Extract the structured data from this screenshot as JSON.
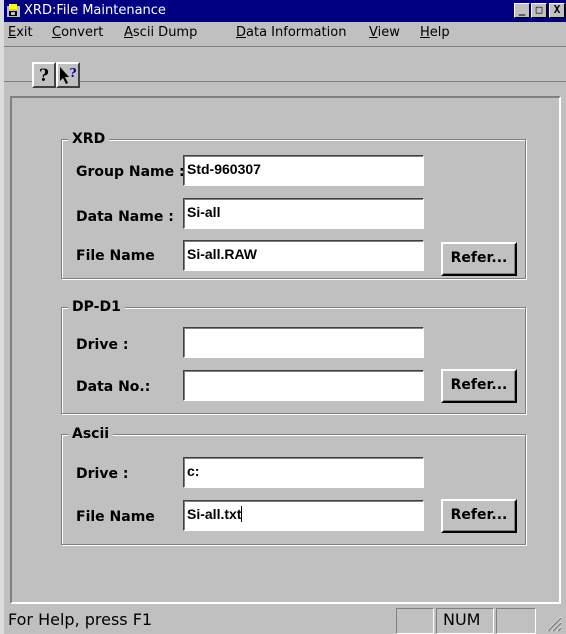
{
  "window": {
    "title": "XRD:File Maintenance",
    "controls": {
      "minimize": "_",
      "maximize": "□",
      "close": "X"
    }
  },
  "menu": [
    {
      "label": "Exit",
      "accel": "E",
      "rest": "xit"
    },
    {
      "label": "Convert",
      "accel": "C",
      "rest": "onvert"
    },
    {
      "label": "Ascii Dump",
      "accel": "A",
      "rest": "scii Dump"
    },
    {
      "label": "Data Information",
      "accel": "D",
      "rest": "ata Information"
    },
    {
      "label": "View",
      "accel": "V",
      "rest": "iew"
    },
    {
      "label": "Help",
      "accel": "H",
      "rest": "elp"
    }
  ],
  "toolbar": {
    "help_icon": "question-mark-icon",
    "context_help_icon": "arrow-question-icon"
  },
  "xrd": {
    "title": "XRD",
    "group_name_label": "Group Name :",
    "group_name_value": "Std-960307",
    "data_name_label": "Data Name :",
    "data_name_value": "Si-all",
    "file_name_label": "File Name",
    "file_name_value": "Si-all.RAW",
    "refer_label": "Refer..."
  },
  "dpd1": {
    "title": "DP-D1",
    "drive_label": "Drive :",
    "drive_value": "",
    "data_no_label": "Data No.:",
    "data_no_value": "",
    "refer_label": "Refer..."
  },
  "ascii": {
    "title": "Ascii",
    "drive_label": "Drive :",
    "drive_value": "c:",
    "file_name_label": "File Name",
    "file_name_value": "Si-all.txt",
    "refer_label": "Refer..."
  },
  "status": {
    "text": "For Help, press F1",
    "num": "NUM"
  }
}
